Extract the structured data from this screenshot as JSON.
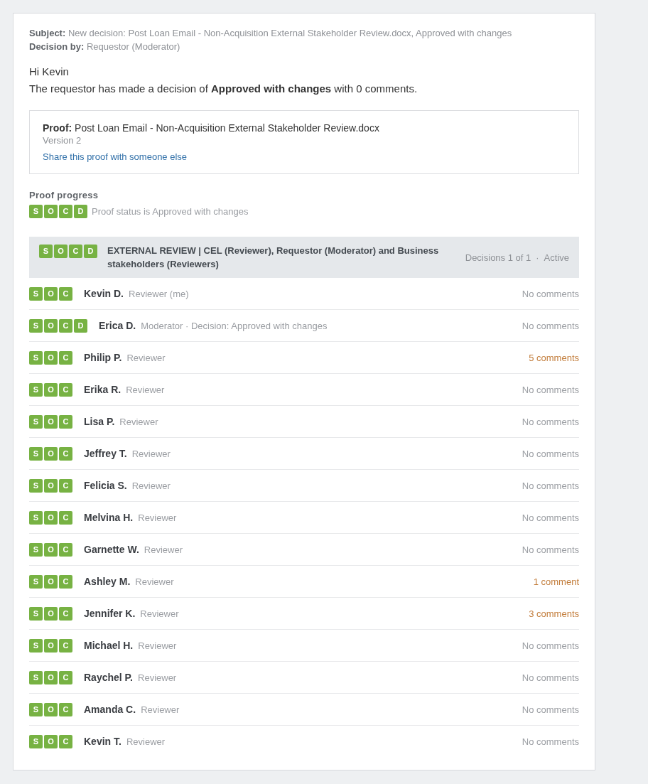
{
  "header": {
    "subject": {
      "label": "Subject:",
      "value": "New decision: Post Loan Email - Non-Acquisition External Stakeholder Review.docx, Approved with changes"
    },
    "decision_by": {
      "label": "Decision by:",
      "value": "Requestor (Moderator)"
    }
  },
  "greeting": "Hi Kevin",
  "message": "The requestor has made a decision of **Approved with changes** with 0 comments.",
  "proof": {
    "label": "Proof:",
    "name": "Post Loan Email - Non-Acquisition External Stakeholder Review.docx",
    "version": "Version 2",
    "share_link": "Share this proof with someone else"
  },
  "progress": {
    "title": "Proof progress",
    "stages": [
      "S",
      "O",
      "C",
      "D"
    ],
    "status": "Proof status is Approved with changes"
  },
  "review_group": {
    "stages": [
      "S",
      "O",
      "C",
      "D"
    ],
    "title": "EXTERNAL REVIEW | CEL (Reviewer), Requestor (Moderator) and Business stakeholders (Reviewers)",
    "decisions": "Decisions 1 of 1",
    "separator": "·",
    "status": "Active"
  },
  "reviewers": [
    {
      "stages": [
        "S",
        "O",
        "C"
      ],
      "name": "Kevin D.",
      "role": "Reviewer (me)",
      "comments": "No comments",
      "has_comments": false
    },
    {
      "stages": [
        "S",
        "O",
        "C",
        "D"
      ],
      "name": "Erica D.",
      "role": "Moderator · Decision: Approved with changes",
      "comments": "No comments",
      "has_comments": false
    },
    {
      "stages": [
        "S",
        "O",
        "C"
      ],
      "name": "Philip P.",
      "role": "Reviewer",
      "comments": "5 comments",
      "has_comments": true
    },
    {
      "stages": [
        "S",
        "O",
        "C"
      ],
      "name": "Erika R.",
      "role": "Reviewer",
      "comments": "No comments",
      "has_comments": false
    },
    {
      "stages": [
        "S",
        "O",
        "C"
      ],
      "name": "Lisa P.",
      "role": "Reviewer",
      "comments": "No comments",
      "has_comments": false
    },
    {
      "stages": [
        "S",
        "O",
        "C"
      ],
      "name": "Jeffrey T.",
      "role": "Reviewer",
      "comments": "No comments",
      "has_comments": false
    },
    {
      "stages": [
        "S",
        "O",
        "C"
      ],
      "name": "Felicia S.",
      "role": "Reviewer",
      "comments": "No comments",
      "has_comments": false
    },
    {
      "stages": [
        "S",
        "O",
        "C"
      ],
      "name": "Melvina H.",
      "role": "Reviewer",
      "comments": "No comments",
      "has_comments": false
    },
    {
      "stages": [
        "S",
        "O",
        "C"
      ],
      "name": "Garnette W.",
      "role": "Reviewer",
      "comments": "No comments",
      "has_comments": false
    },
    {
      "stages": [
        "S",
        "O",
        "C"
      ],
      "name": "Ashley M.",
      "role": "Reviewer",
      "comments": "1 comment",
      "has_comments": true
    },
    {
      "stages": [
        "S",
        "O",
        "C"
      ],
      "name": "Jennifer K.",
      "role": "Reviewer",
      "comments": "3 comments",
      "has_comments": true
    },
    {
      "stages": [
        "S",
        "O",
        "C"
      ],
      "name": "Michael H.",
      "role": "Reviewer",
      "comments": "No comments",
      "has_comments": false
    },
    {
      "stages": [
        "S",
        "O",
        "C"
      ],
      "name": "Raychel P.",
      "role": "Reviewer",
      "comments": "No comments",
      "has_comments": false
    },
    {
      "stages": [
        "S",
        "O",
        "C"
      ],
      "name": "Amanda C.",
      "role": "Reviewer",
      "comments": "No comments",
      "has_comments": false
    },
    {
      "stages": [
        "S",
        "O",
        "C"
      ],
      "name": "Kevin T.",
      "role": "Reviewer",
      "comments": "No comments",
      "has_comments": false
    }
  ]
}
